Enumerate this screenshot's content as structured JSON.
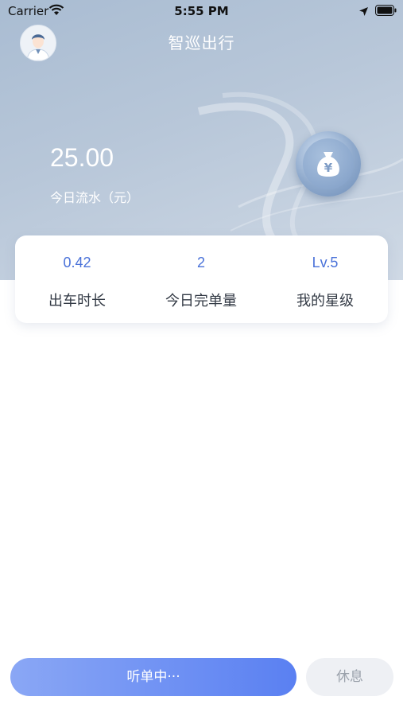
{
  "status_bar": {
    "carrier": "Carrier",
    "time": "5:55 PM",
    "icons": [
      "wifi-icon",
      "location-arrow-icon",
      "battery-icon"
    ]
  },
  "header": {
    "title": "智巡出行",
    "avatar_icon": "driver-avatar"
  },
  "revenue": {
    "amount": "25.00",
    "label": "今日流水（元）",
    "icon": "money-bag-yen-icon"
  },
  "stats": [
    {
      "value": "0.42",
      "label": "出车时长"
    },
    {
      "value": "2",
      "label": "今日完单量"
    },
    {
      "value": "Lv.5",
      "label": "我的星级"
    }
  ],
  "actions": {
    "listen_label": "听单中···",
    "rest_label": "休息"
  },
  "colors": {
    "accent": "#4a72d9",
    "button_gradient_start": "#8aa7f5",
    "button_gradient_end": "#5a80f2",
    "hero_bg": "#b8c7d9"
  }
}
